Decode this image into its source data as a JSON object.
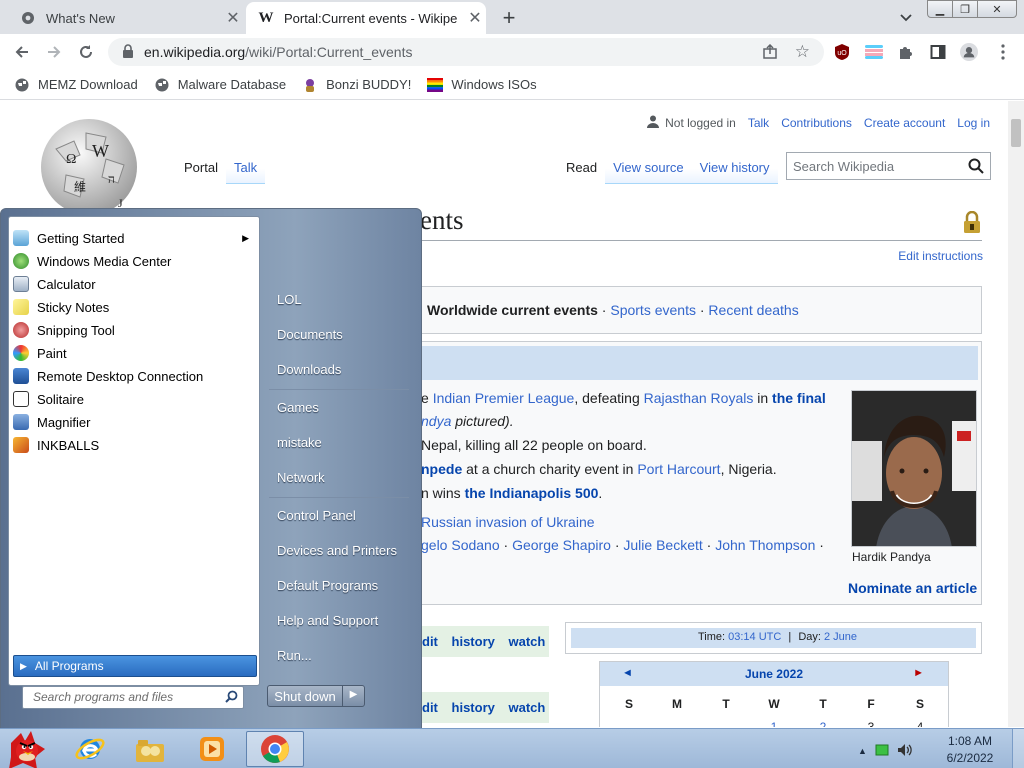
{
  "browser": {
    "tabs": [
      {
        "title": "What's New"
      },
      {
        "title": "Portal:Current events - Wikipe"
      }
    ],
    "url_host": "en.wikipedia.org",
    "url_path": "/wiki/Portal:Current_events",
    "bookmarks": [
      "MEMZ Download",
      "Malware Database",
      "Bonzi BUDDY!",
      "Windows ISOs"
    ]
  },
  "wiki": {
    "user": {
      "not_logged_in": "Not logged in",
      "talk": "Talk",
      "contributions": "Contributions",
      "create_account": "Create account",
      "login": "Log in"
    },
    "left_tabs": [
      "Portal",
      "Talk"
    ],
    "right_tabs": [
      "Read",
      "View source",
      "View history"
    ],
    "search_placeholder": "Search Wikipedia",
    "title_fragment": "ents",
    "edit_instructions": "Edit instructions",
    "header": {
      "worldwide": "Worldwide current events",
      "sep1": " · ",
      "sports": "Sports events",
      "sep2": " · ",
      "deaths": "Recent deaths"
    },
    "news": {
      "l1_pre": "e ",
      "l1_a": "Indian Premier League",
      "l1_b": ", defeating ",
      "l1_c": "Rajasthan Royals",
      "l1_d": " in ",
      "l1_e": "the final",
      "l2_a": "ndya",
      "l2_b": " pictured).",
      "l3": "Nepal, killing all 22 people on board.",
      "l4_a": "npede",
      "l4_b": " at a church charity event in ",
      "l4_c": "Port Harcourt",
      "l4_d": ", Nigeria.",
      "l5_a": "n wins ",
      "l5_b": "the Indianapolis 500",
      "l5_c": ".",
      "l6": "Russian invasion of Ukraine",
      "l7_a": "gelo Sodano",
      "l7_b": " · ",
      "l7_c": "George Shapiro",
      "l7_d": " · ",
      "l7_e": "Julie Beckett",
      "l7_f": " · ",
      "l7_g": "John Thompson",
      "l7_h": " ·"
    },
    "photo_caption": "Hardik Pandya",
    "nominate": "Nominate an article",
    "action_links": [
      "dit",
      "history",
      "watch"
    ],
    "time_label": "Time",
    "time_value": "03:14 UTC",
    "time_sep": "|",
    "day_label": "Day",
    "day_value": "2 June",
    "calendar": {
      "month": "June 2022",
      "prev": "◄",
      "next": "►",
      "dows": [
        "S",
        "M",
        "T",
        "W",
        "T",
        "F",
        "S"
      ],
      "first_row": [
        "",
        "",
        "",
        "1",
        "2",
        "3",
        "4"
      ]
    }
  },
  "startmenu": {
    "programs": [
      "Getting Started",
      "Windows Media Center",
      "Calculator",
      "Sticky Notes",
      "Snipping Tool",
      "Paint",
      "Remote Desktop Connection",
      "Solitaire",
      "Magnifier",
      "INKBALLS"
    ],
    "all_programs": "All Programs",
    "search_placeholder": "Search programs and files",
    "right_links": [
      "LOL",
      "Documents",
      "Downloads",
      "Games",
      "mistake",
      "Network",
      "Control Panel",
      "Devices and Printers",
      "Default Programs",
      "Help and Support",
      "Run..."
    ],
    "shutdown": "Shut down"
  },
  "taskbar": {
    "time": "1:08 AM",
    "date": "6/2/2022"
  },
  "colors": {
    "link": "#3366cc",
    "dark_link": "#0645ad",
    "taskbar": "#a9c2e0",
    "allprogs": "#3a84d8"
  }
}
